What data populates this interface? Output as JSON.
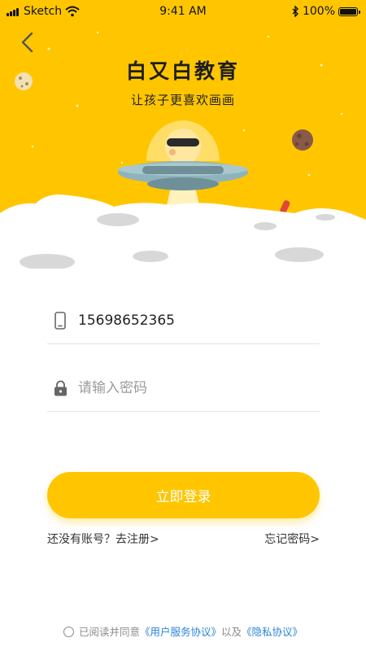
{
  "status_bar": {
    "carrier": "Sketch",
    "time": "9:41 AM",
    "battery": "100%"
  },
  "brand": {
    "title": "白又白教育",
    "subtitle": "让孩子更喜欢画画"
  },
  "login": {
    "phone_value": "15698652365",
    "password_placeholder": "请输入密码",
    "submit_label": "立即登录",
    "register_label": "还没有账号？去注册>",
    "forgot_label": "忘记密码>"
  },
  "agreement": {
    "prefix": "已阅读并同意",
    "terms_label": "《用户服务协议》",
    "connector": "以及",
    "privacy_label": "《隐私协议》"
  },
  "colors": {
    "primary_yellow": "#ffc600",
    "link_blue": "#2a84d8",
    "moon_white": "#ffffff",
    "crater_gray": "#d8d8d8",
    "ufo_steel": "#8fb3bc"
  },
  "icons": {
    "back": "chevron-left-icon",
    "phone": "phone-icon",
    "password": "lock-icon",
    "wifi": "wifi-icon",
    "bluetooth": "bluetooth-icon"
  }
}
